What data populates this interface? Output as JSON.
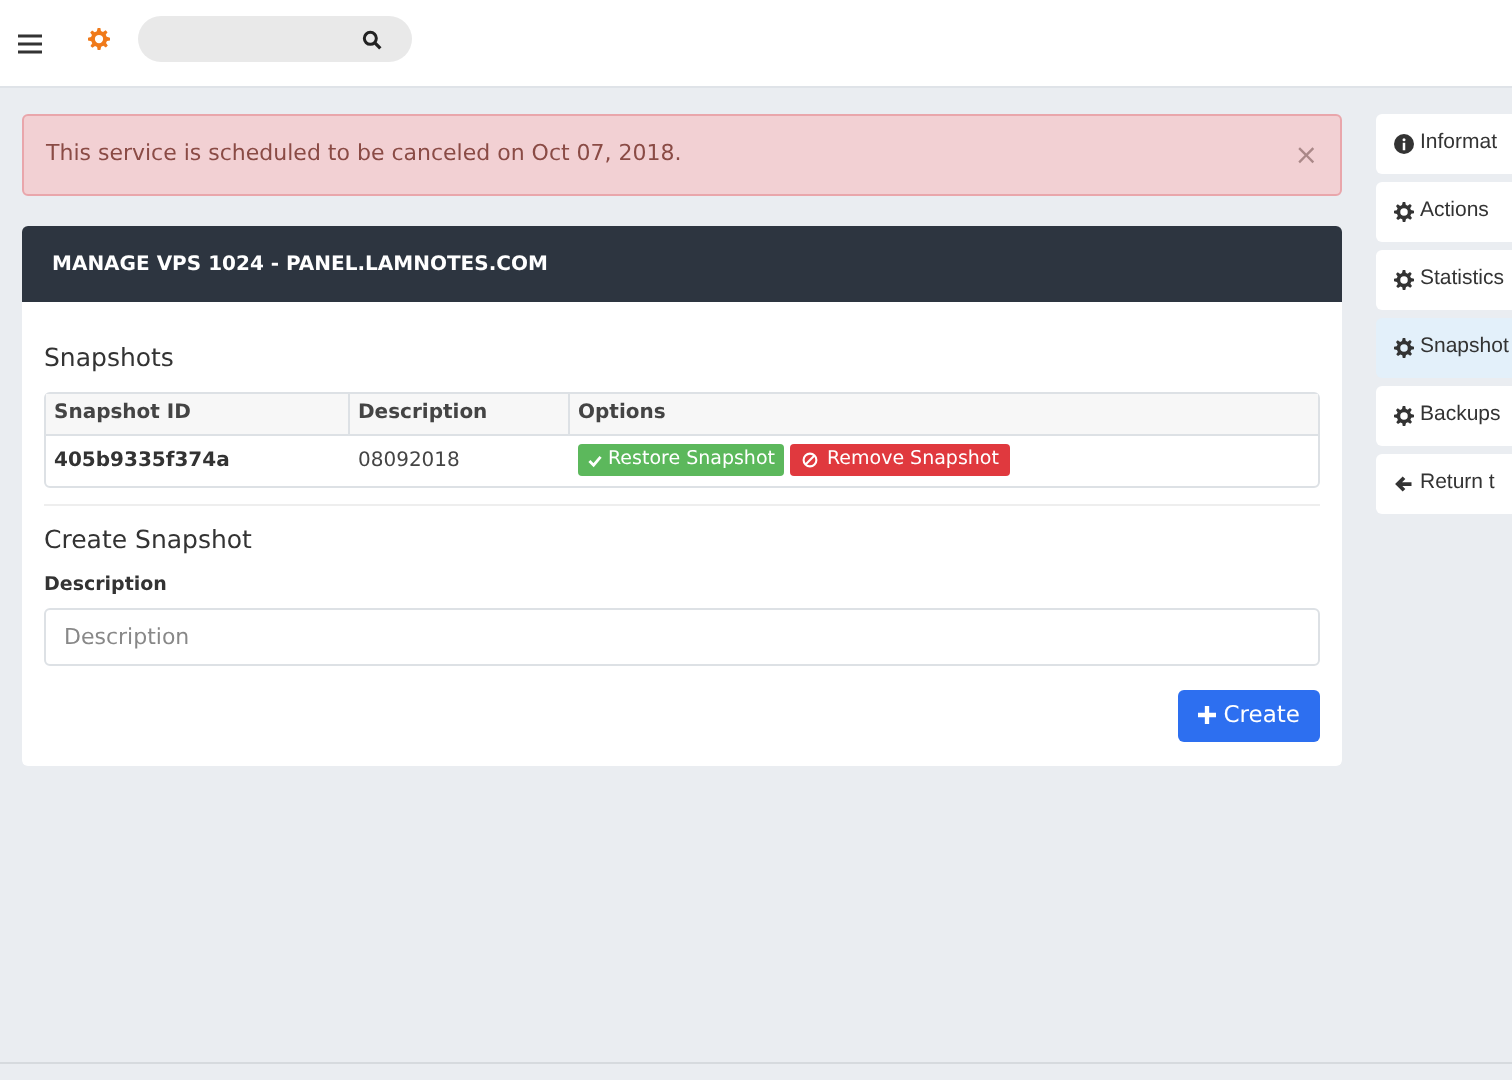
{
  "alert": {
    "text": "This service is scheduled to be canceled on Oct 07, 2018.",
    "close": "×"
  },
  "panel": {
    "title": "MANAGE VPS 1024 - PANEL.LAMNOTES.COM",
    "snapshots": {
      "heading": "Snapshots",
      "columns": [
        "Snapshot ID",
        "Description",
        "Options"
      ],
      "rows": [
        {
          "id": "405b9335f374a",
          "description": "08092018",
          "restore": "Restore Snapshot",
          "remove": "Remove Snapshot"
        }
      ]
    },
    "create": {
      "heading": "Create Snapshot",
      "label": "Description",
      "placeholder": "Description",
      "button": "Create"
    }
  },
  "side_menu": [
    {
      "label": "Informat",
      "kind": "info",
      "selected": false
    },
    {
      "label": "Actions",
      "kind": "gear",
      "selected": false
    },
    {
      "label": "Statistics",
      "kind": "gear",
      "selected": false
    },
    {
      "label": "Snapshot",
      "kind": "gear",
      "selected": true
    },
    {
      "label": "Backups",
      "kind": "gear",
      "selected": false
    },
    {
      "label": "Return t",
      "kind": "back",
      "selected": false
    }
  ]
}
